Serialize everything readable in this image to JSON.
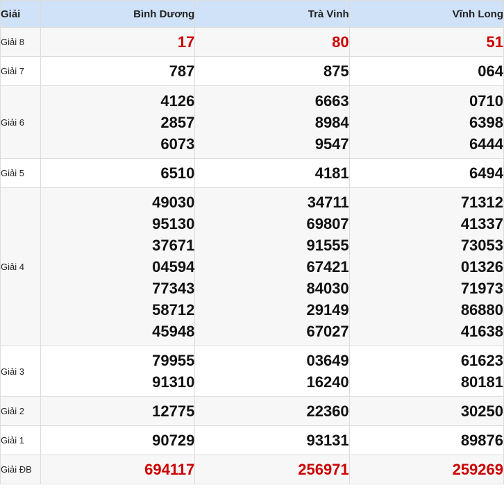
{
  "header": {
    "label": "Giải",
    "provinces": [
      "Bình Dương",
      "Trà Vinh",
      "Vĩnh Long"
    ]
  },
  "rows": [
    {
      "label": "Giải 8",
      "highlight": true,
      "cells": [
        [
          "17"
        ],
        [
          "80"
        ],
        [
          "51"
        ]
      ]
    },
    {
      "label": "Giải 7",
      "highlight": false,
      "cells": [
        [
          "787"
        ],
        [
          "875"
        ],
        [
          "064"
        ]
      ]
    },
    {
      "label": "Giải 6",
      "highlight": false,
      "cells": [
        [
          "4126",
          "2857",
          "6073"
        ],
        [
          "6663",
          "8984",
          "9547"
        ],
        [
          "0710",
          "6398",
          "6444"
        ]
      ]
    },
    {
      "label": "Giải 5",
      "highlight": false,
      "cells": [
        [
          "6510"
        ],
        [
          "4181"
        ],
        [
          "6494"
        ]
      ]
    },
    {
      "label": "Giải 4",
      "highlight": false,
      "cells": [
        [
          "49030",
          "95130",
          "37671",
          "04594",
          "77343",
          "58712",
          "45948"
        ],
        [
          "34711",
          "69807",
          "91555",
          "67421",
          "84030",
          "29149",
          "67027"
        ],
        [
          "71312",
          "41337",
          "73053",
          "01326",
          "71973",
          "86880",
          "41638"
        ]
      ]
    },
    {
      "label": "Giải 3",
      "highlight": false,
      "cells": [
        [
          "79955",
          "91310"
        ],
        [
          "03649",
          "16240"
        ],
        [
          "61623",
          "80181"
        ]
      ]
    },
    {
      "label": "Giải 2",
      "highlight": false,
      "cells": [
        [
          "12775"
        ],
        [
          "22360"
        ],
        [
          "30250"
        ]
      ]
    },
    {
      "label": "Giải 1",
      "highlight": false,
      "cells": [
        [
          "90729"
        ],
        [
          "93131"
        ],
        [
          "89876"
        ]
      ]
    },
    {
      "label": "Giải ĐB",
      "highlight": true,
      "cells": [
        [
          "694117"
        ],
        [
          "256971"
        ],
        [
          "259269"
        ]
      ]
    }
  ],
  "colors": {
    "header_bg": "#cfe2f8",
    "highlight_text": "#cc0000",
    "normal_text": "#111111",
    "alt_row_bg": "#f7f7f7"
  }
}
